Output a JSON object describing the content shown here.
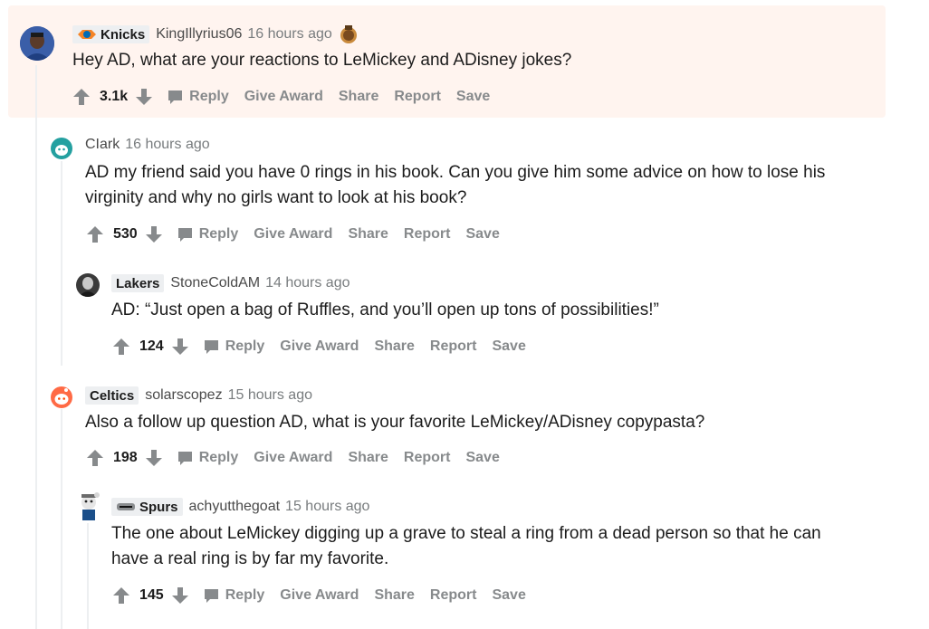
{
  "actions": {
    "reply": "Reply",
    "give_award": "Give Award",
    "share": "Share",
    "report": "Report",
    "save": "Save"
  },
  "comments": [
    {
      "flair": "Knicks",
      "flair_icon": "knicks-logo-icon",
      "author": "KingIllyrius06",
      "time": "16 hours ago",
      "award_icon": "award-icon",
      "body": [
        "Hey AD, what are your reactions to LeMickey and ADisney jokes?"
      ],
      "score": "3.1k",
      "highlighted": true
    },
    {
      "author": "CIark",
      "time": "16 hours ago",
      "body": [
        "AD my friend said you have 0 rings in his book. Can you give him some advice on how to lose his",
        "virginity and why no girls want to look at his book?"
      ],
      "score": "530"
    },
    {
      "flair": "Lakers",
      "author": "StoneColdAM",
      "time": "14 hours ago",
      "body": [
        "AD: “Just open a bag of Ruffles, and you’ll open up tons of possibilities!”"
      ],
      "score": "124"
    },
    {
      "flair": "Celtics",
      "author": "solarscopez",
      "time": "15 hours ago",
      "body": [
        "Also a follow up question AD, what is your favorite LeMickey/ADisney copypasta?"
      ],
      "score": "198"
    },
    {
      "flair": "Spurs",
      "flair_icon": "spurs-logo-icon",
      "author": "achyutthegoat",
      "time": "15 hours ago",
      "body": [
        "The one about LeMickey digging up a grave to steal a ring from a dead person so that he can",
        "have a real ring is by far my favorite."
      ],
      "score": "145"
    }
  ],
  "colors": {
    "highlight_bg": "#fff4ef",
    "action_gray": "#878a8c",
    "thread_line": "#edeff1"
  }
}
